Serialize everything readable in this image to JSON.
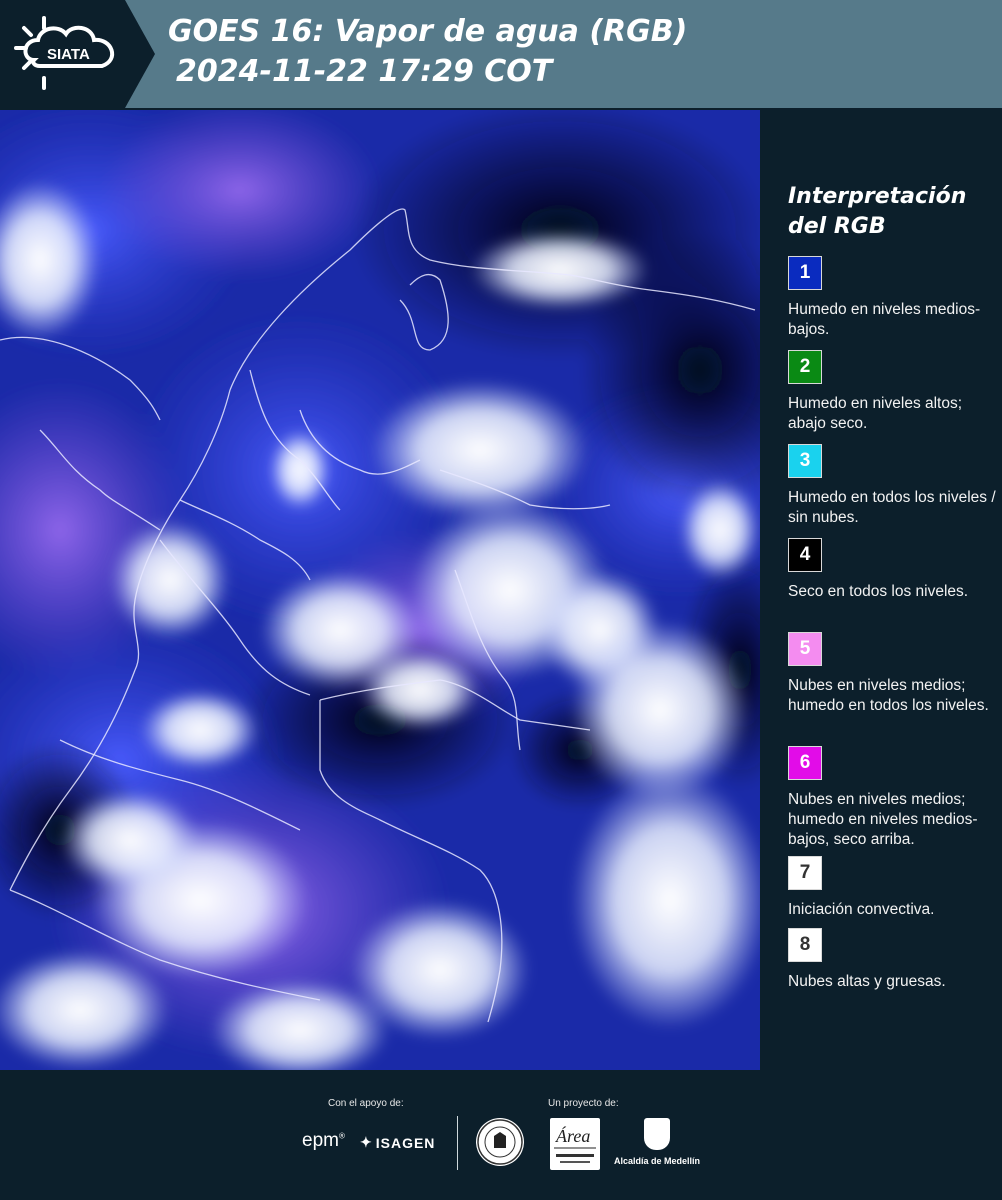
{
  "header": {
    "logo_text": "SIATA",
    "title": "GOES 16: Vapor de agua (RGB)",
    "datetime": "2024-11-22 17:29 COT"
  },
  "legend": {
    "title_line1": "Interpretación",
    "title_line2": "del RGB",
    "items": [
      {
        "num": "1",
        "color": "#0a2bbf",
        "text_color": "#ffffff",
        "text": "Humedo en niveles medios-bajos."
      },
      {
        "num": "2",
        "color": "#0a8a14",
        "text_color": "#ffffff",
        "text": "Humedo en niveles altos; abajo seco."
      },
      {
        "num": "3",
        "color": "#1ad2ee",
        "text_color": "#ffffff",
        "text": "Humedo en todos los niveles / sin nubes."
      },
      {
        "num": "4",
        "color": "#000000",
        "text_color": "#ffffff",
        "text": "Seco en todos los niveles."
      },
      {
        "num": "5",
        "color": "#f48cf0",
        "text_color": "#ffffff",
        "text": "Nubes en niveles medios; humedo en todos los niveles."
      },
      {
        "num": "6",
        "color": "#e20ce8",
        "text_color": "#ffffff",
        "text": "Nubes en niveles medios; humedo en niveles medios-bajos, seco arriba."
      },
      {
        "num": "7",
        "color": "#ffffff",
        "text_color": "#333333",
        "text": "Iniciación convectiva."
      },
      {
        "num": "8",
        "color": "#ffffff",
        "text_color": "#333333",
        "text": "Nubes altas y gruesas."
      }
    ]
  },
  "footer": {
    "support_label": "Con el apoyo de:",
    "project_label": "Un proyecto de:",
    "sponsors": [
      "epm",
      "ISAGEN"
    ],
    "projects": [
      "Área Metropolitana Valle de Aburrá",
      "Alcaldía de Medellín"
    ],
    "alcaldia_text": "Alcaldía de Medellín"
  }
}
